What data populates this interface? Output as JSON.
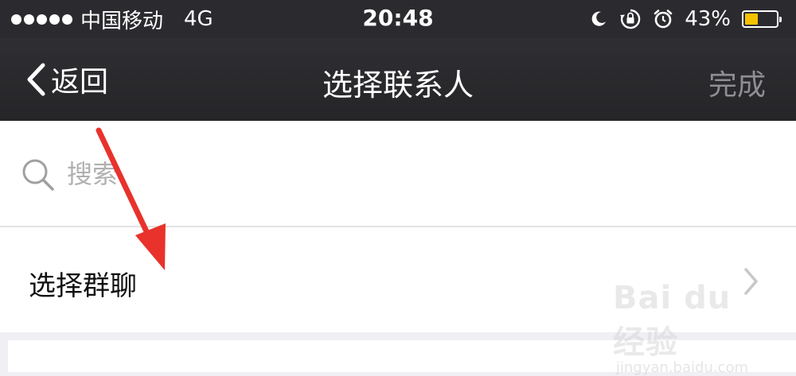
{
  "status_bar": {
    "carrier": "中国移动",
    "network": "4G",
    "time": "20:48",
    "battery_percent_text": "43%",
    "battery_level": 0.43,
    "icons": [
      "moon-icon",
      "rotation-lock-icon",
      "alarm-icon",
      "battery-icon"
    ]
  },
  "nav": {
    "back_label": "返回",
    "title": "选择联系人",
    "done_label": "完成"
  },
  "search": {
    "placeholder": "搜索",
    "value": ""
  },
  "list": {
    "select_group_label": "选择群聊"
  },
  "watermark": {
    "brand": "Bai du 经验",
    "url": "jingyan.baidu.com"
  },
  "colors": {
    "nav_background": "#2b2b2f",
    "battery_fill": "#f5c200",
    "annotation_arrow": "#e8322b",
    "done_disabled": "#8e8e93"
  }
}
